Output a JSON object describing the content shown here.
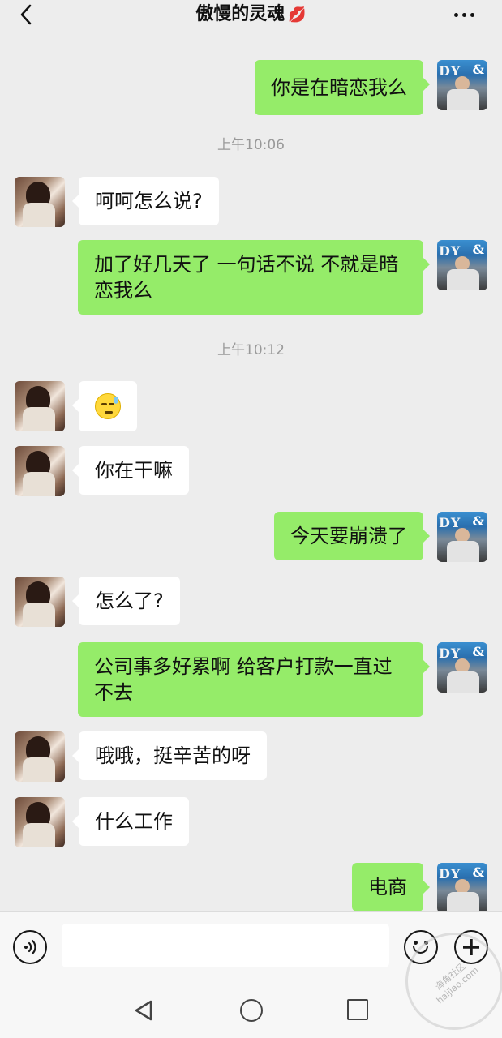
{
  "header": {
    "title": "傲慢的灵魂",
    "title_emoji": "💋",
    "back_icon": "chevron-left-icon",
    "more_icon": "more-horizontal-icon"
  },
  "messages": [
    {
      "from": "me",
      "text": "你是在暗恋我么"
    },
    {
      "type": "time",
      "text": "上午10:06"
    },
    {
      "from": "them",
      "text": "呵呵怎么说?"
    },
    {
      "from": "me",
      "text": "加了好几天了 一句话不说 不就是暗恋我么"
    },
    {
      "type": "time",
      "text": "上午10:12"
    },
    {
      "from": "them",
      "emoji": "sweat-smile-emoji"
    },
    {
      "from": "them",
      "text": "你在干嘛"
    },
    {
      "from": "me",
      "text": "今天要崩溃了"
    },
    {
      "from": "them",
      "text": "怎么了?"
    },
    {
      "from": "me",
      "text": "公司事多好累啊 给客户打款一直过不去"
    },
    {
      "from": "them",
      "text": "哦哦，挺辛苦的呀"
    },
    {
      "from": "them",
      "text": "什么工作"
    },
    {
      "from": "me",
      "text": "电商"
    }
  ],
  "avatars": {
    "me": {
      "text_left": "DY",
      "text_right": "&"
    }
  },
  "input_bar": {
    "value": "",
    "voice_icon": "voice-icon",
    "emoji_icon": "emoji-icon",
    "plus_icon": "plus-icon"
  },
  "nav_bar": {
    "back_icon": "nav-back-icon",
    "home_icon": "nav-home-icon",
    "recent_icon": "nav-recent-icon"
  },
  "watermark": {
    "line1": "海角社区",
    "line2": "haijiao.com"
  },
  "colors": {
    "background": "#ededed",
    "my_bubble": "#95ec69",
    "their_bubble": "#ffffff",
    "timestamp": "#999999"
  }
}
